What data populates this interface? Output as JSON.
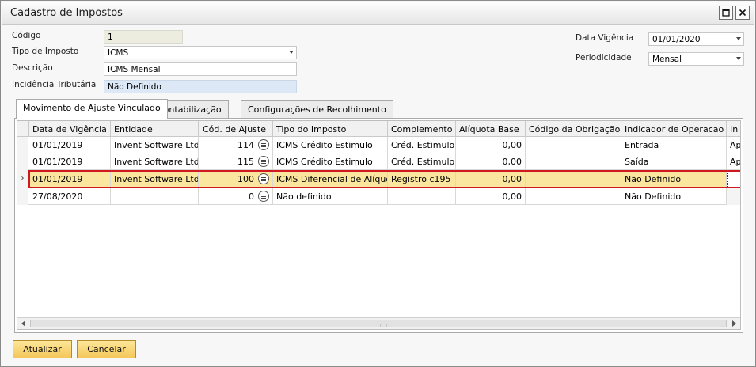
{
  "window": {
    "title": "Cadastro de Impostos",
    "maximize_icon": "maximize-icon",
    "close_icon": "close-icon"
  },
  "form": {
    "codigo": {
      "label": "Código",
      "value": "1"
    },
    "tipo_imposto": {
      "label": "Tipo de Imposto",
      "value": "ICMS"
    },
    "descricao": {
      "label": "Descrição",
      "value": "ICMS Mensal"
    },
    "incidencia": {
      "label": "Incidência Tributária",
      "value": "Não Definido"
    },
    "data_vigencia": {
      "label": "Data Vigência",
      "value": "01/01/2020"
    },
    "periodicidade": {
      "label": "Periodicidade",
      "value": "Mensal"
    }
  },
  "tabs": [
    {
      "label": "Movimento de Ajuste Vinculado",
      "active": true
    },
    {
      "label": "Contabilização",
      "active": false
    },
    {
      "label": "Configurações de Recolhimento",
      "active": false
    }
  ],
  "grid": {
    "columns": [
      "Data de Vigência",
      "Entidade",
      "Cód. de Ajuste",
      "Tipo do Imposto",
      "Complemento",
      "Alíquota Base",
      "Código da Obrigação",
      "Indicador de Operacao",
      "In"
    ],
    "rows": [
      {
        "data": "01/01/2019",
        "entidade": "Invent Software Ltda",
        "cod_ajuste": "114",
        "tipo": "ICMS Crédito Estimulo",
        "complemento": "Créd. Estimulo",
        "aliquota": "0,00",
        "codigo_obrigacao": "",
        "indicador": "Entrada",
        "extra": "Ap"
      },
      {
        "data": "01/01/2019",
        "entidade": "Invent Software Ltda",
        "cod_ajuste": "115",
        "tipo": "ICMS Crédito Estimulo",
        "complemento": "Créd. Estimulo",
        "aliquota": "0,00",
        "codigo_obrigacao": "",
        "indicador": "Saída",
        "extra": "Ap"
      },
      {
        "data": "01/01/2019",
        "entidade": "Invent Software Ltda",
        "cod_ajuste": "100",
        "tipo": "ICMS Diferencial de Alíquota",
        "complemento": "Registro c195",
        "aliquota": "0,00",
        "codigo_obrigacao": "",
        "indicador": "Não Definido",
        "extra": "",
        "selected": true
      },
      {
        "data": "27/08/2020",
        "entidade": "",
        "cod_ajuste": "0",
        "tipo": "Não definido",
        "complemento": "",
        "aliquota": "0,00",
        "codigo_obrigacao": "",
        "indicador": "Não Definido",
        "extra": ""
      }
    ],
    "selected_row_marker": "›"
  },
  "buttons": {
    "atualizar": "Atualizar",
    "cancelar": "Cancelar"
  },
  "colors": {
    "selected_row": "#fbe6a0",
    "selection_outline": "#d0191f",
    "button_gold": "#f4c75a"
  }
}
